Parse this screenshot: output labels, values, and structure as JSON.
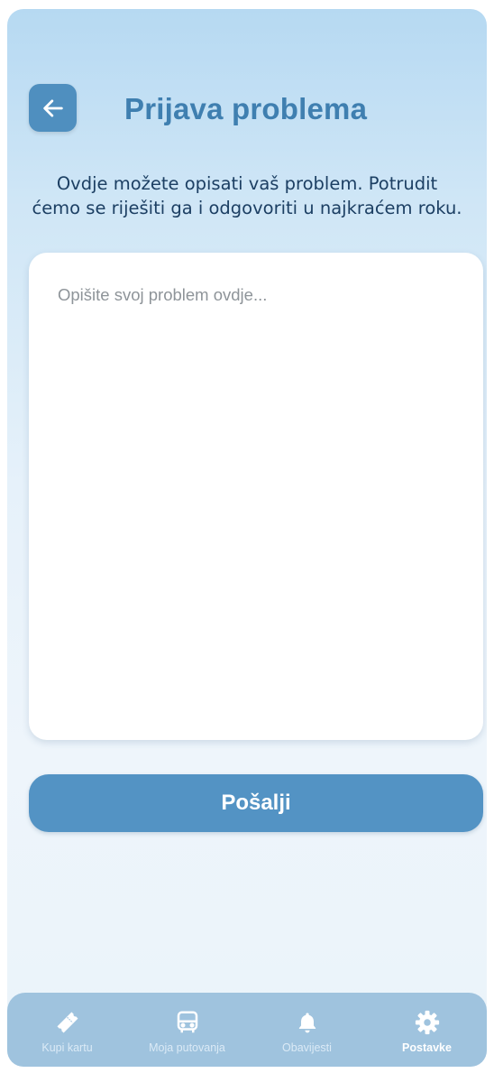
{
  "header": {
    "title": "Prijava problema",
    "back_icon": "arrow-left-icon"
  },
  "intro": {
    "line1": "Ovdje možete opisati vaš problem. Potrudit",
    "line2": "ćemo se riješiti ga i odgovoriti u najkraćem roku."
  },
  "problem_input": {
    "placeholder": "Opišite svoj problem ovdje...",
    "value": ""
  },
  "send_button": {
    "label": "Pošalji"
  },
  "tabbar": {
    "items": [
      {
        "label": "Kupi kartu",
        "icon": "ticket-icon",
        "active": false
      },
      {
        "label": "Moja putovanja",
        "icon": "bus-icon",
        "active": false
      },
      {
        "label": "Obavijesti",
        "icon": "bell-icon",
        "active": false
      },
      {
        "label": "Postavke",
        "icon": "gear-icon",
        "active": true
      }
    ]
  },
  "colors": {
    "accent": "#5393c4",
    "title": "#3f7fb0",
    "tabbar": "#9fc3de"
  }
}
